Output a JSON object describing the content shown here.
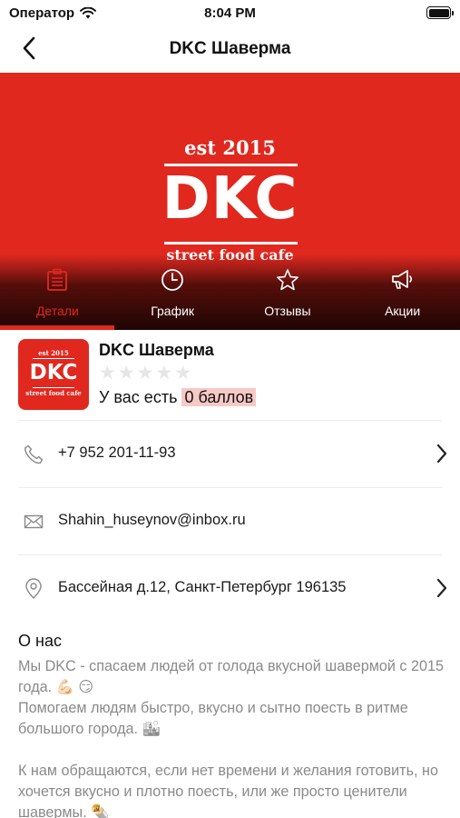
{
  "status_bar": {
    "carrier": "Оператор",
    "time": "8:04 PM"
  },
  "nav": {
    "title": "DKC Шаверма"
  },
  "hero": {
    "logo_est": "est 2015",
    "logo_main": "DKC",
    "logo_sub": "street food cafe",
    "accent_color": "#e0281f"
  },
  "tabs": [
    {
      "label": "Детали",
      "icon": "clipboard-icon",
      "active": true
    },
    {
      "label": "График",
      "icon": "clock-icon",
      "active": false
    },
    {
      "label": "Отзывы",
      "icon": "star-icon",
      "active": false
    },
    {
      "label": "Акции",
      "icon": "megaphone-icon",
      "active": false
    }
  ],
  "company": {
    "name": "DKC Шаверма",
    "rating": 0,
    "rating_max": 5,
    "points_prefix": "У вас есть",
    "points_value": "0 баллов"
  },
  "contacts": {
    "phone": "+7 952 201-11-93",
    "email": "Shahin_huseynov@inbox.ru",
    "address": "Бассейная д.12, Санкт-Петербург 196135"
  },
  "about": {
    "title": "О нас",
    "line1": "Мы DKC - спасаем людей от голода вкусной шавермой с 2015 года. 💪🏻 😏",
    "line2": "Помогаем людям быстро, вкусно и сытно поесть в ритме большого города. 🏙",
    "line3": "К нам обращаются, если нет времени и желания готовить, но хочется вкусно и плотно поесть, или же просто ценители шавермы. 🌯"
  }
}
